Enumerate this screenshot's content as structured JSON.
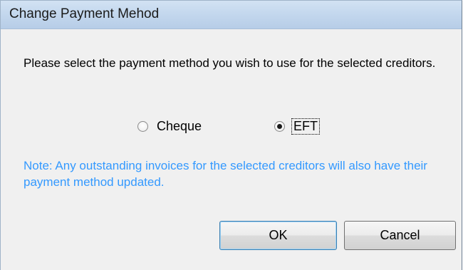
{
  "window": {
    "title": "Change Payment Mehod"
  },
  "dialog": {
    "prompt": "Please select the payment method you wish to use for the selected creditors.",
    "options": [
      {
        "label": "Cheque",
        "selected": false
      },
      {
        "label": "EFT",
        "selected": true
      }
    ],
    "note": "Note: Any outstanding invoices for the selected creditors will also have their payment method updated.",
    "note_color": "#3399ff"
  },
  "buttons": {
    "ok_label": "OK",
    "cancel_label": "Cancel"
  }
}
